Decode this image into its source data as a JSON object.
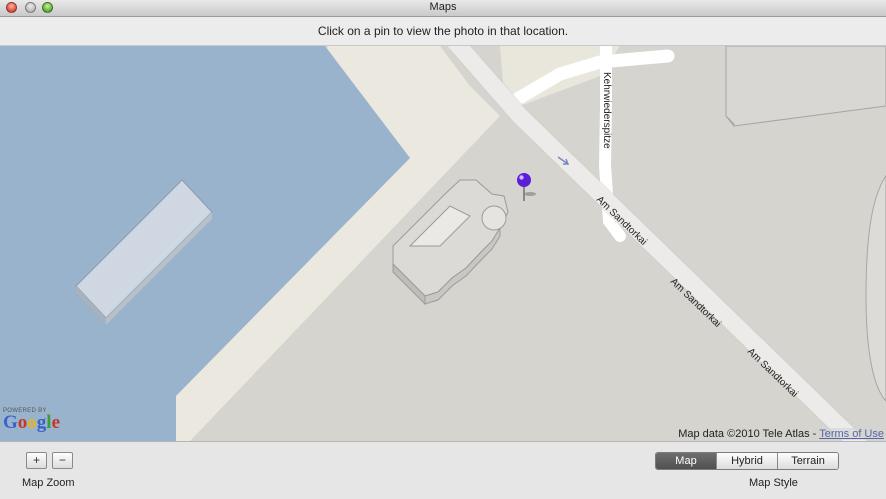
{
  "window": {
    "title": "Maps"
  },
  "instructions": "Click on a pin to view the photo in that location.",
  "map": {
    "street_labels": [
      "Kehrwiederspitze",
      "Am Sandtorkai",
      "Am Sandtorkai",
      "Am Sandtorkai"
    ],
    "pin_color": "#5b1fd6",
    "water_color": "#99b3cc",
    "logo": {
      "powered_by": "POWERED BY",
      "name": "Google"
    },
    "attribution": {
      "text": "Map data ©2010 Tele Atlas - ",
      "link": "Terms of Use"
    }
  },
  "zoom": {
    "plus": "+",
    "minus": "−",
    "label": "Map Zoom"
  },
  "style": {
    "options": [
      "Map",
      "Hybrid",
      "Terrain"
    ],
    "selected": "Map",
    "label": "Map Style"
  }
}
